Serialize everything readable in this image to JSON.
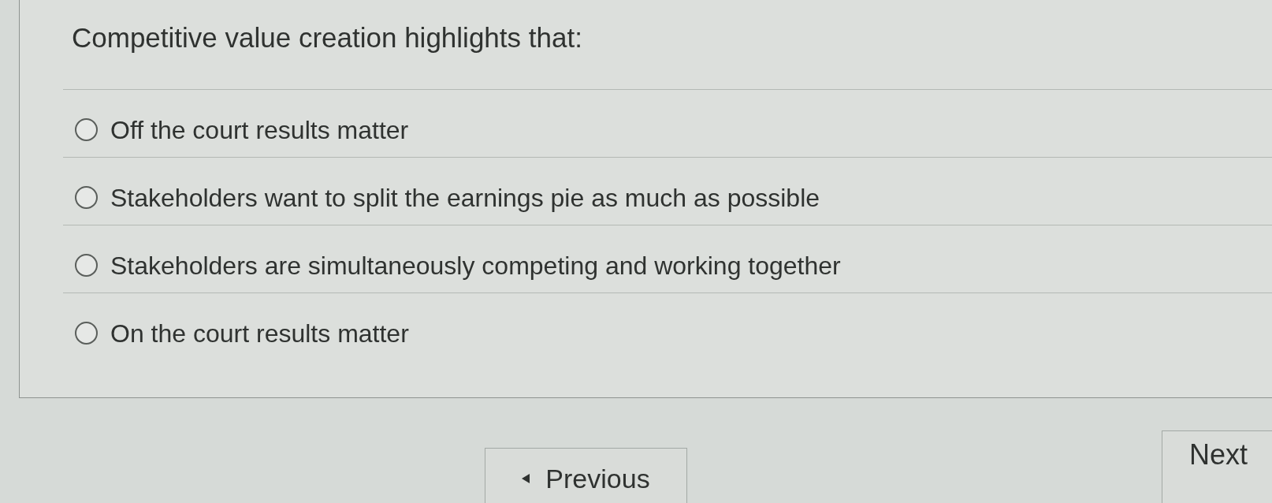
{
  "question": {
    "prompt": "Competitive value creation highlights that:"
  },
  "options": [
    {
      "label": "Off the court results matter",
      "selected": false
    },
    {
      "label": "Stakeholders want to split the earnings pie as much as possible",
      "selected": false
    },
    {
      "label": "Stakeholders are simultaneously competing and working together",
      "selected": false
    },
    {
      "label": "On the court results matter",
      "selected": false
    }
  ],
  "navigation": {
    "previous": "Previous",
    "next": "Next"
  }
}
